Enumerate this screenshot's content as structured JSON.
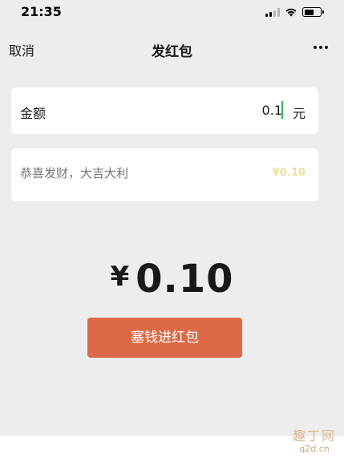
{
  "status_bar": {
    "time": "21:35",
    "signal_icon": "cellular-signal-icon",
    "wifi_icon": "wifi-icon",
    "battery_icon": "battery-icon",
    "battery_level": 0.6
  },
  "nav": {
    "cancel_label": "取消",
    "title": "发红包",
    "more_icon": "more-dots-icon"
  },
  "amount": {
    "label": "金额",
    "value": "0.1",
    "unit": "元"
  },
  "greeting": {
    "placeholder": "恭喜发财，大吉大利",
    "amount_hint": "¥0.10"
  },
  "total": {
    "currency": "¥",
    "value": "0.10"
  },
  "send_button": {
    "label": "塞钱进红包",
    "color": "#dd6a47"
  },
  "watermark": {
    "top": "趣丁网",
    "bottom": "q2d.cn"
  }
}
